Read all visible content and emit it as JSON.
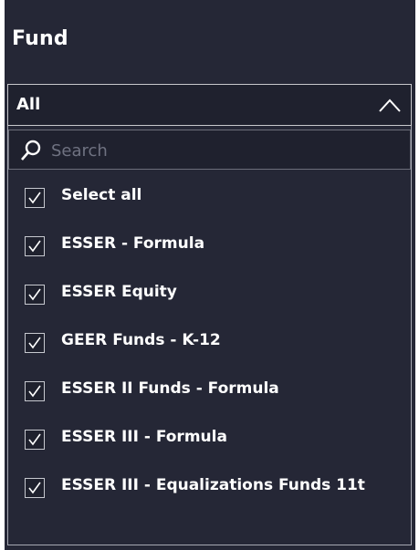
{
  "slicer": {
    "title": "Fund",
    "selected_value": "All",
    "search_placeholder": "Search",
    "items": [
      {
        "label": "Select all",
        "checked": true
      },
      {
        "label": "ESSER - Formula",
        "checked": true
      },
      {
        "label": "ESSER Equity",
        "checked": true
      },
      {
        "label": "GEER Funds - K-12",
        "checked": true
      },
      {
        "label": "ESSER II Funds - Formula",
        "checked": true
      },
      {
        "label": "ESSER III - Formula",
        "checked": true
      },
      {
        "label": "ESSER III - Equalizations Funds 11t",
        "checked": true
      }
    ]
  },
  "icons": {
    "search": "search-icon",
    "chevron": "chevron-up-icon",
    "check": "checkmark-icon"
  },
  "colors": {
    "panel_bg": "#252736",
    "text": "#ffffff",
    "border": "#c8c8cc",
    "placeholder": "#6f7281"
  }
}
